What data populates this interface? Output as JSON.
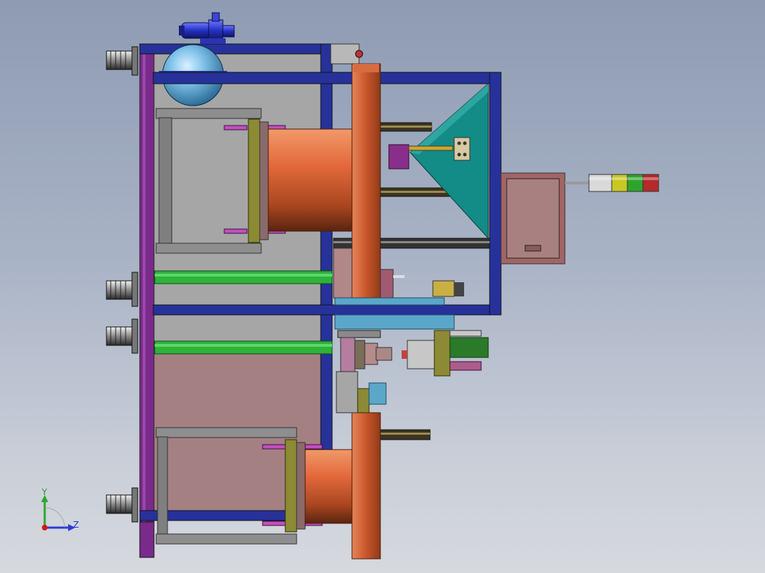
{
  "view": {
    "description_label": "",
    "triad": {
      "y_label": "Y",
      "z_label": "Z",
      "x_color": "#d01a1a",
      "y_color": "#2fa52f",
      "z_color": "#2a3bd8"
    }
  },
  "colors": {
    "frame_blue": "#26329a",
    "frame_purple": "#7a2a8a",
    "plate_gray": "#a9a9a9",
    "plate_rose": "#a47d7f",
    "copper": "#c8552c",
    "teal_hopper": "#138b86",
    "green_rail": "#2db23a",
    "olive_plate": "#8c8a34",
    "cabinet": "#a26566",
    "stack_light": [
      "#d9d9d9",
      "#c8c824",
      "#2da52d",
      "#b52a2a"
    ]
  },
  "components": [
    "left-leveling-feet",
    "main-frame",
    "air-tank",
    "vacuum-pump",
    "upper-copper-roller",
    "lower-copper-roller",
    "copper-disc",
    "teal-hopper",
    "electrical-cabinet",
    "stack-light",
    "green-guide-rails",
    "mechanism-cluster"
  ]
}
